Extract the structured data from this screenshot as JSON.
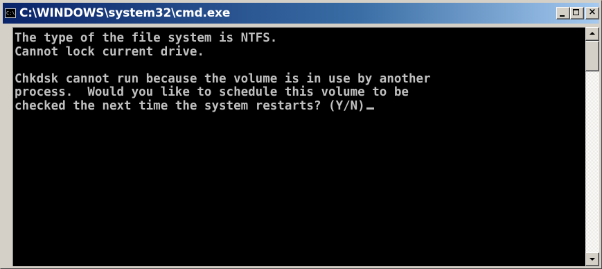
{
  "window": {
    "title": "C:\\WINDOWS\\system32\\cmd.exe",
    "icon_text": "C:\\",
    "buttons": {
      "minimize": "minimize-icon",
      "maximize": "maximize-icon",
      "close": "×"
    }
  },
  "console": {
    "lines": [
      "The type of the file system is NTFS.",
      "Cannot lock current drive.",
      "",
      "Chkdsk cannot run because the volume is in use by another",
      "process.  Would you like to schedule this volume to be",
      "checked the next time the system restarts? (Y/N)"
    ]
  },
  "colors": {
    "titlebar": "#0a246a",
    "console_background": "#000000",
    "console_text": "#c0c0c0"
  }
}
